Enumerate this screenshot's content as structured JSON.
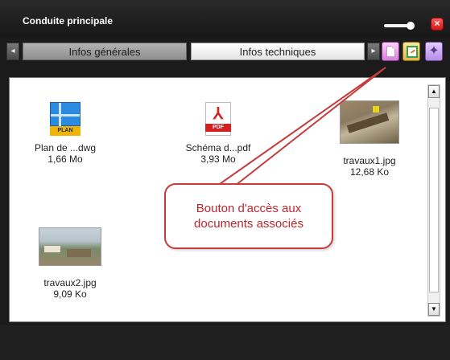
{
  "window": {
    "title": "Conduite principale"
  },
  "tabs": [
    {
      "label": "Infos générales",
      "selected": false
    },
    {
      "label": "Infos techniques",
      "selected": true
    }
  ],
  "toolbar": {
    "buttons": [
      {
        "icon": "document-icon",
        "color": "#d67cd9"
      },
      {
        "icon": "edit-icon",
        "color": "#e0b64a"
      },
      {
        "icon": "navigation-icon",
        "color": "#b48ae5"
      }
    ]
  },
  "files": [
    {
      "name": "Plan de ...dwg",
      "size": "1,66 Mo",
      "icon": "plan-file-icon",
      "icon_label": "PLAN"
    },
    {
      "name": "Schéma d...pdf",
      "size": "3,93 Mo",
      "icon": "pdf-file-icon",
      "icon_label": "PDF"
    },
    {
      "name": "travaux1.jpg",
      "size": "12,68 Ko",
      "icon": "image-thumbnail"
    },
    {
      "name": "travaux2.jpg",
      "size": "9,09 Ko",
      "icon": "image-thumbnail"
    }
  ],
  "callout": {
    "line1": "Bouton d'accès aux",
    "line2": "documents associés",
    "color": "#c63b3b"
  }
}
